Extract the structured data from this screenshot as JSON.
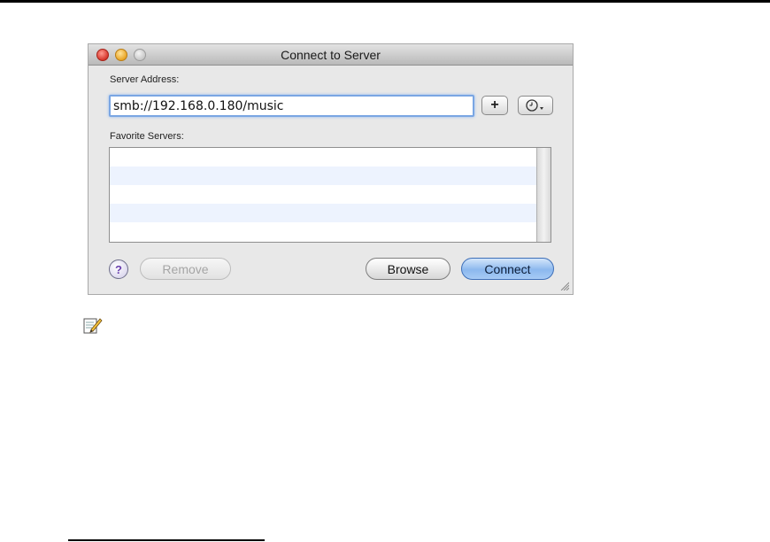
{
  "window": {
    "title": "Connect to Server",
    "server_address_label": "Server Address:",
    "server_address_value": "smb://192.168.0.180/music",
    "add_button_label": "+",
    "recent_icon": "clock-dropdown-icon",
    "favorite_servers_label": "Favorite Servers:",
    "favorite_servers": [],
    "help_label": "?",
    "remove_label": "Remove",
    "browse_label": "Browse",
    "connect_label": "Connect"
  },
  "icons": {
    "note": "note-pencil-icon",
    "resize": "resize-grip-icon"
  },
  "colors": {
    "accent": "#8cb8ee",
    "focus_ring": "#7aa6e3",
    "close": "#d6372c",
    "minimize": "#e9a526"
  }
}
